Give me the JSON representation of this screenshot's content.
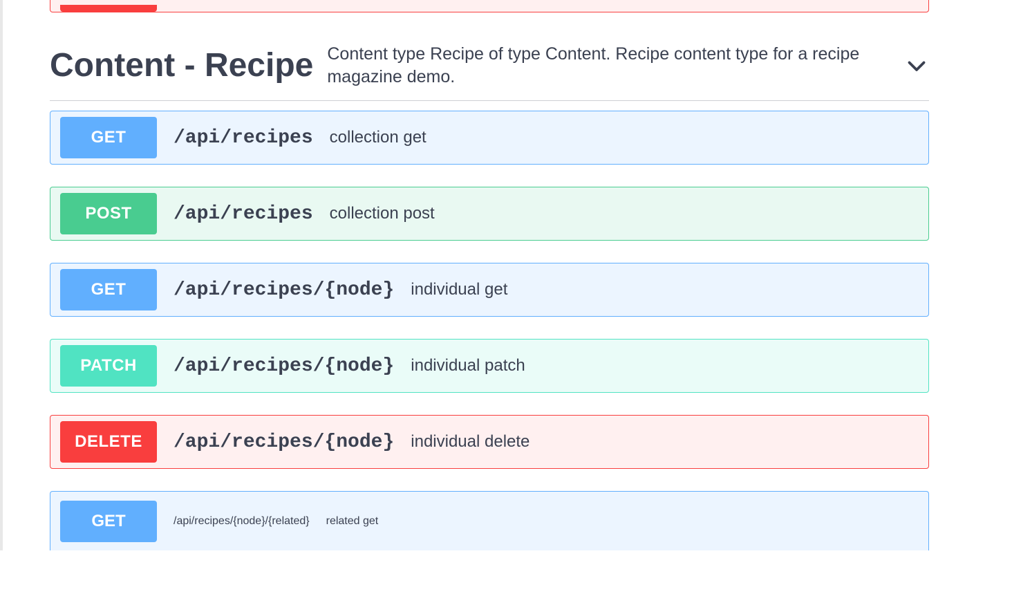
{
  "section": {
    "title": "Content - Recipe",
    "description": "Content type Recipe of type Content. Recipe content type for a recipe magazine demo."
  },
  "ops": [
    {
      "method": "GET",
      "path": "/api/recipes",
      "summary": "collection get",
      "kind": "get"
    },
    {
      "method": "POST",
      "path": "/api/recipes",
      "summary": "collection post",
      "kind": "post"
    },
    {
      "method": "GET",
      "path": "/api/recipes/{node}",
      "summary": "individual get",
      "kind": "get"
    },
    {
      "method": "PATCH",
      "path": "/api/recipes/{node}",
      "summary": "individual patch",
      "kind": "patch"
    },
    {
      "method": "DELETE",
      "path": "/api/recipes/{node}",
      "summary": "individual delete",
      "kind": "delete"
    }
  ],
  "trailing": {
    "method": "GET",
    "path": "/api/recipes/{node}/{related}",
    "summary": "related get",
    "kind": "get"
  },
  "colors": {
    "get": "#61affe",
    "post": "#49cc90",
    "patch": "#50e3c2",
    "delete": "#f93e3e"
  }
}
